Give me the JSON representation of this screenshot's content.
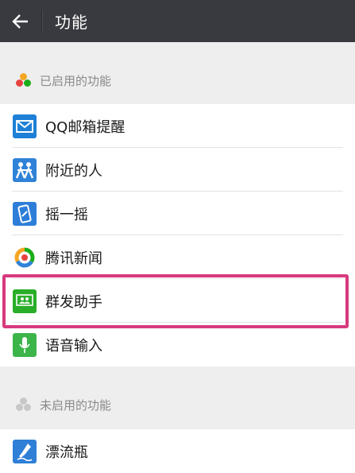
{
  "header": {
    "title": "功能",
    "back_icon": "arrow-left-icon"
  },
  "enabled_section": {
    "title": "已启用的功能",
    "icon": "three-dots-icon",
    "colors": [
      "#e64340",
      "#1aad19",
      "#f5a623"
    ],
    "items": [
      {
        "label": "QQ邮箱提醒",
        "icon": "mail-icon",
        "color": "#1d80d6"
      },
      {
        "label": "附近的人",
        "icon": "people-nearby-icon",
        "color": "#2f82d8"
      },
      {
        "label": "摇一摇",
        "icon": "shake-phone-icon",
        "color": "#2d7ed8"
      },
      {
        "label": "腾讯新闻",
        "icon": "tencent-news-icon",
        "color": "#1aad19"
      },
      {
        "label": "群发助手",
        "icon": "group-message-icon",
        "color": "#2aae29"
      },
      {
        "label": "语音输入",
        "icon": "microphone-icon",
        "color": "#3bb54a"
      }
    ]
  },
  "disabled_section": {
    "title": "未启用的功能",
    "icon": "three-dots-gray-icon",
    "items": [
      {
        "label": "漂流瓶",
        "icon": "drift-bottle-icon",
        "color": "#2f7fd6"
      }
    ]
  },
  "highlight_color": "#d73a7c"
}
